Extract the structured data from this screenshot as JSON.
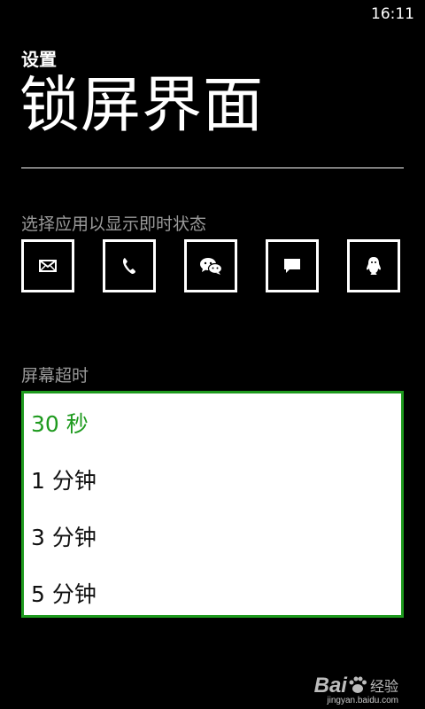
{
  "status_bar": {
    "time": "16:11"
  },
  "header": {
    "settings_label": "设置",
    "title": "锁屏界面"
  },
  "apps_section": {
    "label": "选择应用以显示即时状态",
    "apps": [
      {
        "icon": "mail-icon"
      },
      {
        "icon": "phone-icon"
      },
      {
        "icon": "wechat-icon"
      },
      {
        "icon": "message-icon"
      },
      {
        "icon": "qq-icon"
      }
    ]
  },
  "timeout_section": {
    "label": "屏幕超时",
    "options": [
      "30 秒",
      "1 分钟",
      "3 分钟",
      "5 分钟"
    ],
    "selected": "30 秒",
    "accent_color": "#1e9a1e"
  },
  "watermark": {
    "brand_prefix": "Bai",
    "brand_suffix": "经验",
    "url": "jingyan.baidu.com"
  }
}
